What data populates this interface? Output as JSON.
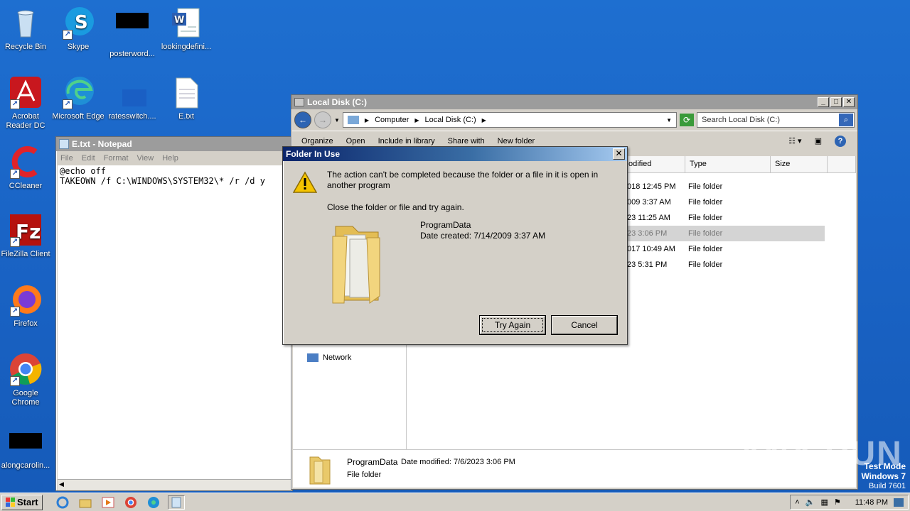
{
  "desktop": {
    "icons": [
      {
        "label": "Recycle Bin",
        "icon": "recycle-bin-icon"
      },
      {
        "label": "Skype",
        "icon": "skype-icon"
      },
      {
        "label": "posterword...",
        "icon": "redacted-icon"
      },
      {
        "label": "lookingdefini...",
        "icon": "word-document-icon"
      },
      {
        "label": "Acrobat Reader DC",
        "icon": "acrobat-icon"
      },
      {
        "label": "Microsoft Edge",
        "icon": "edge-icon"
      },
      {
        "label": "ratesswitch....",
        "icon": "generic-file-icon"
      },
      {
        "label": "E.txt",
        "icon": "text-file-icon"
      },
      {
        "label": "CCleaner",
        "icon": "ccleaner-icon"
      },
      {
        "label": "FileZilla Client",
        "icon": "filezilla-icon"
      },
      {
        "label": "Firefox",
        "icon": "firefox-icon"
      },
      {
        "label": "Google Chrome",
        "icon": "chrome-icon"
      },
      {
        "label": "alongcarolin...",
        "icon": "redacted-icon"
      }
    ]
  },
  "notepad": {
    "title": "E.txt - Notepad",
    "menu": [
      "File",
      "Edit",
      "Format",
      "View",
      "Help"
    ],
    "content": "@echo off\nTAKEOWN /f C:\\WINDOWS\\SYSTEM32\\* /r /d y"
  },
  "explorer": {
    "title": "Local Disk (C:)",
    "breadcrumb": [
      "Computer",
      "Local Disk (C:)"
    ],
    "search_placeholder": "Search Local Disk (C:)",
    "toolbar": [
      "Organize",
      "Open",
      "Include in library",
      "Share with",
      "New folder"
    ],
    "columns": {
      "modified": "odified",
      "type": "Type",
      "size": "Size"
    },
    "rows": [
      {
        "modified": "018 12:45 PM",
        "type": "File folder",
        "selected": false
      },
      {
        "modified": "009 3:37 AM",
        "type": "File folder",
        "selected": false
      },
      {
        "modified": "23 11:25 AM",
        "type": "File folder",
        "selected": false
      },
      {
        "modified": "23 3:06 PM",
        "type": "File folder",
        "selected": true
      },
      {
        "modified": "017 10:49 AM",
        "type": "File folder",
        "selected": false
      },
      {
        "modified": "23 5:31 PM",
        "type": "File folder",
        "selected": false
      }
    ],
    "nav_network": "Network",
    "details": {
      "name": "ProgramData",
      "modified_label": "Date modified:",
      "modified_value": "7/6/2023 3:06 PM",
      "kind": "File folder"
    }
  },
  "dialog": {
    "title": "Folder In Use",
    "message": "The action can't be completed because the folder or a file in it is open in another program",
    "instruction": "Close the folder or file and try again.",
    "item_name": "ProgramData",
    "item_date": "Date created: 7/14/2009 3:37 AM",
    "try_again": "Try Again",
    "cancel": "Cancel"
  },
  "taskbar": {
    "start": "Start",
    "clock": "11:48 PM"
  },
  "watermark": {
    "line1": "Test Mode",
    "line2": "Windows 7",
    "line3": "Build 7601",
    "brand": "ANY RUN"
  }
}
